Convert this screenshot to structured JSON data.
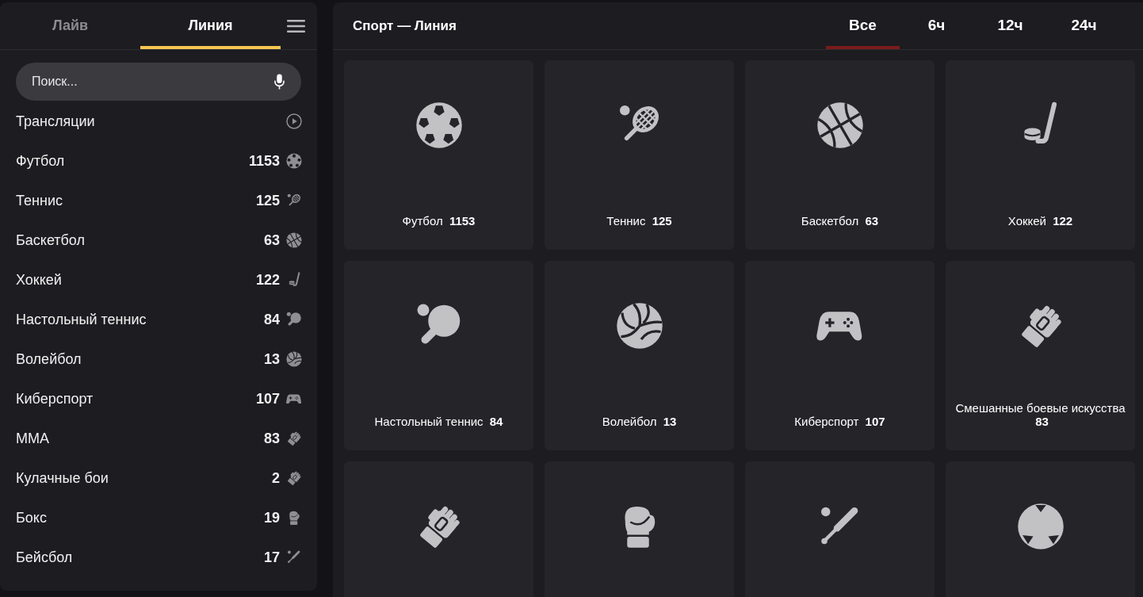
{
  "sidebar": {
    "tabs": [
      {
        "label": "Лайв",
        "selected": false
      },
      {
        "label": "Линия",
        "selected": true
      }
    ],
    "search": {
      "placeholder": "Поиск..."
    },
    "items": [
      {
        "name": "Трансляции",
        "kind": "broadcast"
      },
      {
        "name": "Футбол",
        "count": "1153",
        "kind": "football"
      },
      {
        "name": "Теннис",
        "count": "125",
        "kind": "tennis"
      },
      {
        "name": "Баскетбол",
        "count": "63",
        "kind": "basketball"
      },
      {
        "name": "Хоккей",
        "count": "122",
        "kind": "hockey"
      },
      {
        "name": "Настольный теннис",
        "count": "84",
        "kind": "pingpong"
      },
      {
        "name": "Волейбол",
        "count": "13",
        "kind": "volleyball"
      },
      {
        "name": "Киберспорт",
        "count": "107",
        "kind": "esports"
      },
      {
        "name": "ММА",
        "count": "83",
        "kind": "mma"
      },
      {
        "name": "Кулачные бои",
        "count": "2",
        "kind": "mma"
      },
      {
        "name": "Бокс",
        "count": "19",
        "kind": "boxing"
      },
      {
        "name": "Бейсбол",
        "count": "17",
        "kind": "baseball"
      }
    ]
  },
  "main": {
    "title": "Спорт — Линия",
    "filters": [
      {
        "label": "Все",
        "selected": true
      },
      {
        "label": "6ч",
        "selected": false
      },
      {
        "label": "12ч",
        "selected": false
      },
      {
        "label": "24ч",
        "selected": false
      }
    ],
    "tiles": [
      {
        "name": "Футбол",
        "count": "1153",
        "kind": "football"
      },
      {
        "name": "Теннис",
        "count": "125",
        "kind": "tennis"
      },
      {
        "name": "Баскетбол",
        "count": "63",
        "kind": "basketball"
      },
      {
        "name": "Хоккей",
        "count": "122",
        "kind": "hockey"
      },
      {
        "name": "Настольный теннис",
        "count": "84",
        "kind": "pingpong"
      },
      {
        "name": "Волейбол",
        "count": "13",
        "kind": "volleyball"
      },
      {
        "name": "Киберспорт",
        "count": "107",
        "kind": "esports"
      },
      {
        "name": "Смешанные боевые искусства",
        "count": "83",
        "kind": "mma"
      },
      {
        "kind": "mma"
      },
      {
        "kind": "boxing"
      },
      {
        "kind": "baseball"
      },
      {
        "kind": "ball"
      }
    ]
  }
}
